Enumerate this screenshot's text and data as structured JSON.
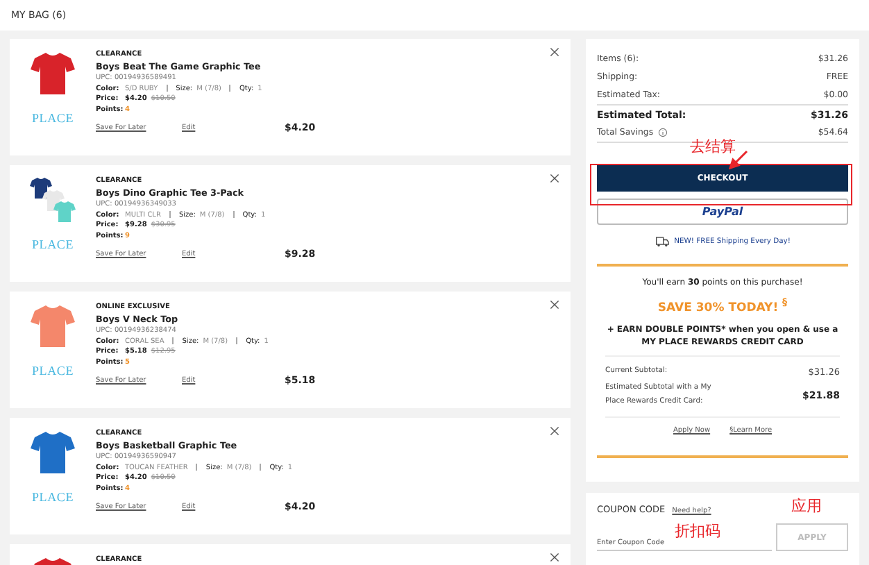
{
  "page_title": "MY BAG (6)",
  "items": [
    {
      "badge": "CLEARANCE",
      "title": "Boys Beat The Game Graphic Tee",
      "upc": "UPC: 00194936589491",
      "image": {
        "kind": "single",
        "color": "#d8232a"
      },
      "logo": "PLACE",
      "attributes": [
        {
          "label": "Color:",
          "value": "S/D RUBY"
        },
        {
          "label": "Size:",
          "value": "M (7/8)"
        },
        {
          "label": "Qty:",
          "value": "1"
        }
      ],
      "price": {
        "label": "Price:",
        "sale": "$4.20",
        "original": "$10.50"
      },
      "points": {
        "label": "Points:",
        "value": "4"
      },
      "save_link": "Save For Later",
      "edit_link": "Edit",
      "total": "$4.20"
    },
    {
      "badge": "CLEARANCE",
      "title": "Boys Dino Graphic Tee 3-Pack",
      "upc": "UPC: 00194936349033",
      "image": {
        "kind": "pack",
        "color": "#1d3b7a"
      },
      "logo": "PLACE",
      "attributes": [
        {
          "label": "Color:",
          "value": "MULTI CLR"
        },
        {
          "label": "Size:",
          "value": "M (7/8)"
        },
        {
          "label": "Qty:",
          "value": "1"
        }
      ],
      "price": {
        "label": "Price:",
        "sale": "$9.28",
        "original": "$30.95"
      },
      "points": {
        "label": "Points:",
        "value": "9"
      },
      "save_link": "Save For Later",
      "edit_link": "Edit",
      "total": "$9.28"
    },
    {
      "badge": "ONLINE EXCLUSIVE",
      "title": "Boys V Neck Top",
      "upc": "UPC: 00194936238474",
      "image": {
        "kind": "single",
        "color": "#f4876b"
      },
      "logo": "PLACE",
      "attributes": [
        {
          "label": "Color:",
          "value": "CORAL SEA"
        },
        {
          "label": "Size:",
          "value": "M (7/8)"
        },
        {
          "label": "Qty:",
          "value": "1"
        }
      ],
      "price": {
        "label": "Price:",
        "sale": "$5.18",
        "original": "$12.95"
      },
      "points": {
        "label": "Points:",
        "value": "5"
      },
      "save_link": "Save For Later",
      "edit_link": "Edit",
      "total": "$5.18"
    },
    {
      "badge": "CLEARANCE",
      "title": "Boys Basketball Graphic Tee",
      "upc": "UPC: 00194936590947",
      "image": {
        "kind": "single",
        "color": "#1f6fc6"
      },
      "logo": "PLACE",
      "attributes": [
        {
          "label": "Color:",
          "value": "TOUCAN FEATHER"
        },
        {
          "label": "Size:",
          "value": "M (7/8)"
        },
        {
          "label": "Qty:",
          "value": "1"
        }
      ],
      "price": {
        "label": "Price:",
        "sale": "$4.20",
        "original": "$10.50"
      },
      "points": {
        "label": "Points:",
        "value": "4"
      },
      "save_link": "Save For Later",
      "edit_link": "Edit",
      "total": "$4.20"
    },
    {
      "badge": "CLEARANCE",
      "image": {
        "kind": "single",
        "color": "#d8232a"
      }
    }
  ],
  "summary": {
    "rows": [
      {
        "label": "Items (6):",
        "value": "$31.26"
      },
      {
        "label": "Shipping:",
        "value": "FREE"
      },
      {
        "label": "Estimated Tax:",
        "value": "$0.00"
      }
    ],
    "total": {
      "label": "Estimated Total:",
      "value": "$31.26"
    },
    "savings": {
      "label": "Total Savings",
      "value": "$54.64"
    },
    "checkout_button": "CHECKOUT",
    "paypal_button": "PayPal",
    "shipping_note": "NEW! FREE Shipping Every Day!"
  },
  "rewards": {
    "earn_text": "You'll earn **30** points on this purchase!",
    "headline": "SAVE 30% TODAY! $^{§}$",
    "promo": "+ EARN DOUBLE POINTS* when you open & use a MY PLACE REWARDS CREDIT CARD",
    "rows": [
      {
        "label": "Current Subtotal:",
        "value": "$31.26",
        "emphasis": false
      },
      {
        "label": "Estimated Subtotal with a My Place Rewards Credit Card:",
        "value": "$21.88",
        "emphasis": true
      }
    ],
    "links": [
      "Apply Now",
      "§Learn More"
    ]
  },
  "coupon": {
    "title": "COUPON CODE",
    "help_link": "Need help?",
    "placeholder": "Enter Coupon Code",
    "apply_button": "APPLY",
    "disabled": true
  },
  "annotations": [
    {
      "kind": "arrow-note",
      "text": "去结算"
    },
    {
      "kind": "note",
      "text": "应用"
    },
    {
      "kind": "note",
      "text": "折扣码"
    }
  ]
}
